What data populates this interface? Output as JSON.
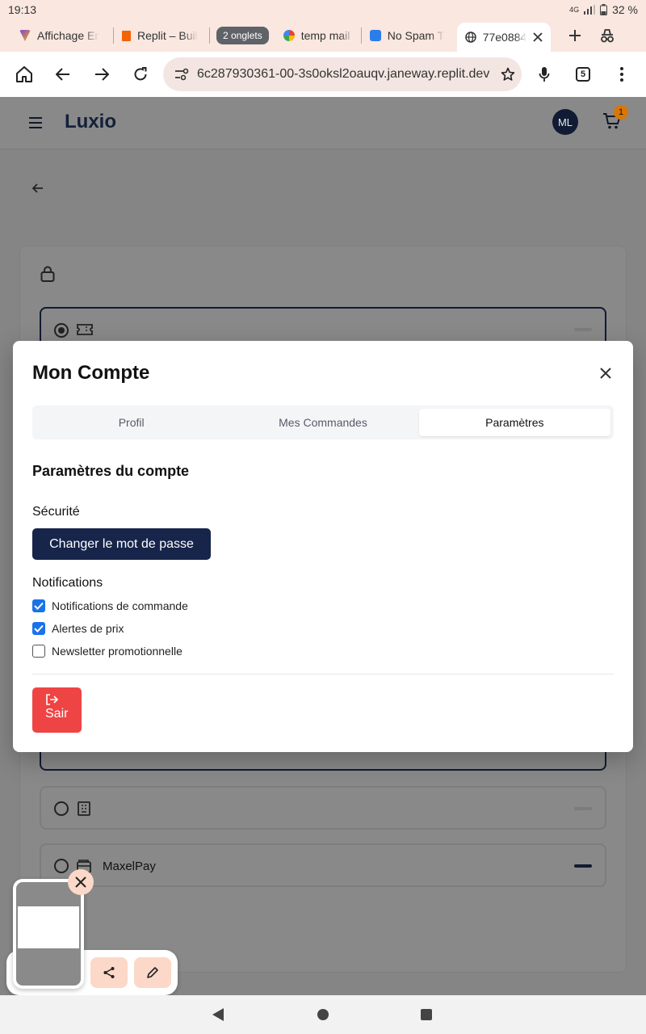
{
  "status_bar": {
    "time": "19:13",
    "network": "4G",
    "battery": "32 %"
  },
  "tabs": [
    {
      "title": "Affichage Er",
      "favicon_color": "#7b3fe4"
    },
    {
      "title": "Replit – Buil",
      "favicon_color": "#f26207"
    },
    {
      "group_label": "2 onglets"
    },
    {
      "title": "temp mail n",
      "favicon_color": "#4285f4"
    },
    {
      "title": "No Spam To",
      "favicon_color": "#2b7de9"
    },
    {
      "title": "77e0884",
      "active": true
    }
  ],
  "toolbar": {
    "url": "6c287930361-00-3s0oksl2oauqv.janeway.replit.dev",
    "tab_count": "5"
  },
  "app": {
    "logo": "Luxio",
    "avatar_initials": "ML",
    "cart_count": "1",
    "payment_option_label": "MaxelPay"
  },
  "modal": {
    "title": "Mon Compte",
    "tabs": [
      "Profil",
      "Mes Commandes",
      "Paramètres"
    ],
    "active_tab": "Paramètres",
    "section_title": "Paramètres du compte",
    "security_label": "Sécurité",
    "change_password_button": "Changer le mot de passe",
    "notifications_label": "Notifications",
    "checkboxes": [
      {
        "label": "Notifications de commande",
        "checked": true
      },
      {
        "label": "Alertes de prix",
        "checked": true
      },
      {
        "label": "Newsletter promotionnelle",
        "checked": false
      }
    ],
    "exit_button": "Sair"
  },
  "colors": {
    "primary": "#17254a",
    "danger": "#ef4444",
    "checkbox": "#1a73e8"
  }
}
